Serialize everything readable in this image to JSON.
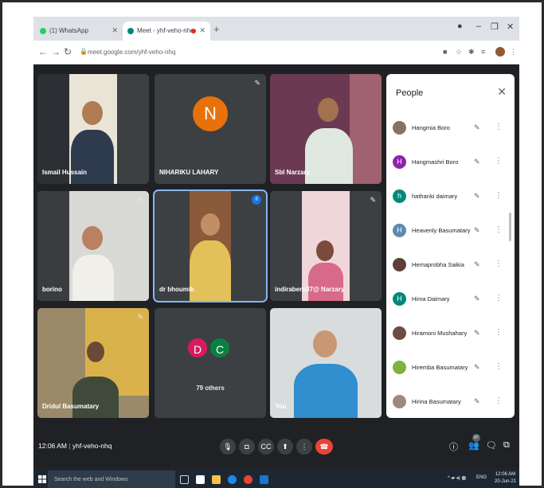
{
  "browser": {
    "tabs": [
      {
        "title": "(1) WhatsApp",
        "favicon_color": "#25d366",
        "active": false
      },
      {
        "title": "Meet - yhf-veho-nhq",
        "favicon_color": "#00897b",
        "active": true
      }
    ],
    "new_tab_icon": "plus-icon",
    "window_controls": [
      "minimize-icon",
      "restore-icon",
      "close-icon"
    ],
    "url": "meet.google.com/yhf-veho-nhq"
  },
  "tiles": [
    {
      "name": "Ismail Hussain",
      "muted": false
    },
    {
      "name": "NIHARIKU LAHARY",
      "muted": true,
      "initial": "N",
      "avatar_color": "#e8710a"
    },
    {
      "name": "Sbl Narzary",
      "muted": false
    },
    {
      "name": "borino",
      "muted": true
    },
    {
      "name": "dr bhoumik",
      "muted": false,
      "speaking": true
    },
    {
      "name": "indirabero37@ Narzary",
      "muted": true
    },
    {
      "name": "Dridul Basumatary",
      "muted": true
    },
    {
      "name": "79 others",
      "initials": [
        "D",
        "C"
      ],
      "colors": [
        "#d81b60",
        "#0b8043"
      ]
    },
    {
      "name": "You",
      "muted": false
    }
  ],
  "people": {
    "title": "People",
    "entries": [
      {
        "name": "Hangmia Boro",
        "initial": "",
        "color": "#8d6e63"
      },
      {
        "name": "Hangmashri Boro",
        "initial": "H",
        "color": "#8e24aa"
      },
      {
        "name": "hathanki daimary",
        "initial": "h",
        "color": "#00897b"
      },
      {
        "name": "Heavenly Basumatary",
        "initial": "H",
        "color": "#5c8ab0"
      },
      {
        "name": "Hemaprobha Saikia",
        "initial": "",
        "color": "#5d4037"
      },
      {
        "name": "Hima Daimary",
        "initial": "H",
        "color": "#00897b"
      },
      {
        "name": "Hiramoni Mushahary",
        "initial": "",
        "color": "#6d4c41"
      },
      {
        "name": "Hiremba Basumatary",
        "initial": "",
        "color": "#7cb342"
      },
      {
        "name": "Hirina Basumatary",
        "initial": "",
        "color": "#a1887f"
      }
    ]
  },
  "bottom_bar": {
    "time": "12:06 AM",
    "meeting_code": "yhf-veho-nhq",
    "participant_count": "87"
  },
  "taskbar": {
    "search_placeholder": "Search the web and Windows",
    "tray_lang": "ENG",
    "clock_time": "12:06 AM",
    "clock_date": "20-Jun-21"
  }
}
